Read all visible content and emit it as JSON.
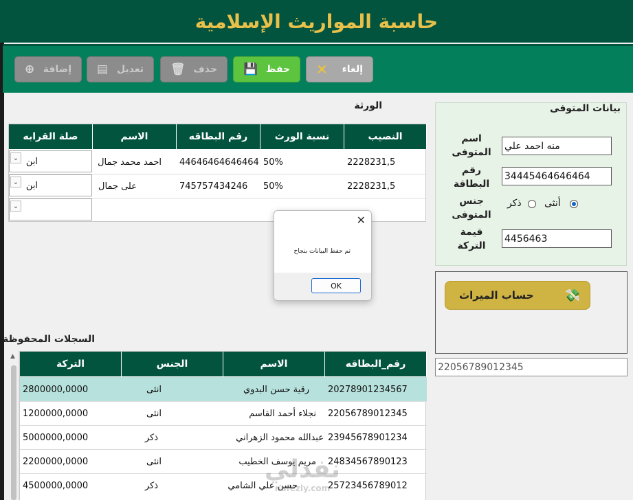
{
  "app": {
    "title": "حاسبة المواريث الإسلامية"
  },
  "toolbar": {
    "add_label": "إضافة",
    "edit_label": "تعديل",
    "delete_label": "حذف",
    "save_label": "حفظ",
    "cancel_label": "إلغاء"
  },
  "heirs": {
    "title": "الورثة",
    "columns": [
      "النصيب",
      "نسبة الورث",
      "رقم البطاقه",
      "الاسم",
      "صلة القرابه"
    ],
    "rows": [
      {
        "share": "2228231,5",
        "ratio": "50%",
        "card": "44646464646464",
        "name": "احمد محمد جمال",
        "relation": "ابن"
      },
      {
        "share": "2228231,5",
        "ratio": "50%",
        "card": "745757434246",
        "name": "على جمال",
        "relation": "ابن"
      }
    ]
  },
  "deceased": {
    "title": "بيانات المتوفى",
    "name_label": "اسم المتوفى",
    "name_value": "منه احمد علي",
    "card_label": "رقم البطاقة",
    "card_value": "34445464646464",
    "gender_label": "جنس المتوفى",
    "female_label": "أنثى",
    "male_label": "ذكر",
    "gender_selected": "female",
    "estate_label": "قيمة التركة",
    "estate_value": "4456463"
  },
  "calc": {
    "button_label": "حساب الميراث",
    "result_value": "22056789012345"
  },
  "dialog": {
    "message": "تم حفظ البيانات بنجاح",
    "ok_label": "OK",
    "close": "✕"
  },
  "records": {
    "title": "السجلات المحفوظة",
    "columns": [
      "رقم_البطاقه",
      "الاسم",
      "الجنس",
      "التركة"
    ],
    "rows": [
      {
        "card": "20278901234567",
        "name": "رقية حسن البدوي",
        "gender": "انثى",
        "estate": "2800000,0000"
      },
      {
        "card": "22056789012345",
        "name": "نجلاء أحمد القاسم",
        "gender": "انثى",
        "estate": "1200000,0000"
      },
      {
        "card": "23945678901234",
        "name": "عبدالله محمود الزهراني",
        "gender": "ذكر",
        "estate": "5000000,0000"
      },
      {
        "card": "24834567890123",
        "name": "مريم يوسف الخطيب",
        "gender": "انثى",
        "estate": "2200000,0000"
      },
      {
        "card": "25723456789012",
        "name": "حسن علي الشامي",
        "gender": "ذكر",
        "estate": "4500000,0000"
      }
    ],
    "selected_index": 0
  },
  "watermark": {
    "big": "نفذلي",
    "small": "nafezly.com"
  },
  "colors": {
    "primary": "#02543e",
    "toolbar": "#03805b",
    "title_gold": "#e8c04a",
    "selected_row": "#b7e1dc",
    "calc_button": "#cfb343"
  }
}
